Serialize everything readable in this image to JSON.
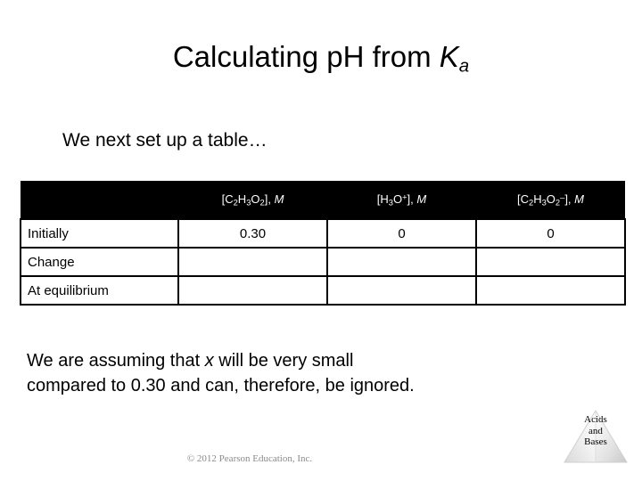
{
  "slide": {
    "title": {
      "text_before": "Calculating pH from ",
      "symbol": "K",
      "subscript": "a"
    },
    "subtitle": "We next set up a table…",
    "table": {
      "headers": [
        {
          "blank": ""
        },
        {
          "formula": "[C2H3O2], M",
          "display": "[C₂H₃O₂], M"
        },
        {
          "formula": "[H3O+], M",
          "display": "[H₃O⁺], M"
        },
        {
          "formula": "[C2H3O2-], M",
          "display": "[C₂H₃O₂⁻], M"
        }
      ],
      "rows": [
        {
          "label": "Initially",
          "cells": [
            "0.30",
            "0",
            "0"
          ]
        },
        {
          "label": "Change",
          "cells": [
            "",
            "",
            ""
          ]
        },
        {
          "label": "At equilibrium",
          "cells": [
            "",
            "",
            ""
          ]
        }
      ]
    },
    "body": {
      "line1_before": "We are assuming that ",
      "line1_var": "x",
      "line1_after": " will be very small",
      "line2": "compared to 0.30 and can, therefore, be ignored."
    },
    "footer": {
      "copyright": "© 2012 Pearson Education, Inc."
    },
    "logo": {
      "line1": "Acids",
      "line2": "and",
      "line3": "Bases"
    }
  },
  "colors": {
    "background": "#ffffff",
    "header_fill": "#000000",
    "header_text": "#ffffff",
    "border": "#000000",
    "body_text": "#000000",
    "copyright_text": "#8a8a8a"
  }
}
